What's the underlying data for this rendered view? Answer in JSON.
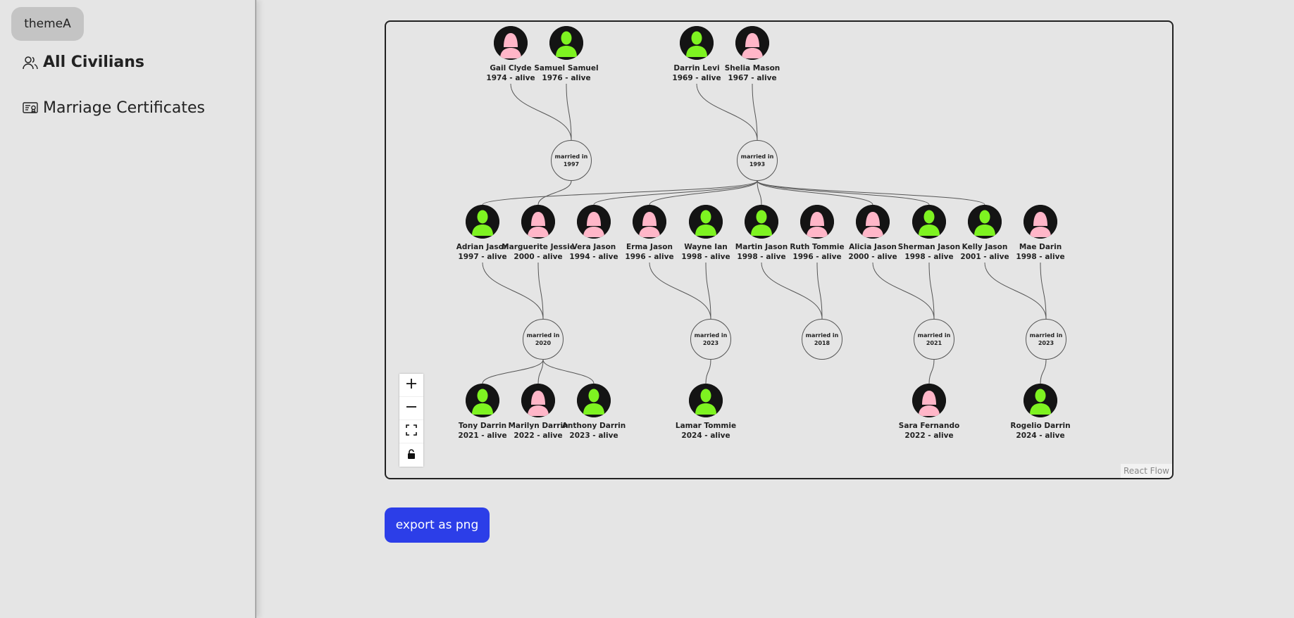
{
  "sidebar": {
    "theme_label": "themeA",
    "nav": {
      "all_civilians": "All Civilians",
      "marriage_certificates": "Marriage Certificates"
    }
  },
  "colors": {
    "male": "#7ef321",
    "female": "#ffb6c8",
    "accent": "#2c3ee8"
  },
  "people": [
    {
      "id": "gail",
      "name": "Gail Clyde",
      "years": "1974 - alive",
      "gender": "female"
    },
    {
      "id": "samuel",
      "name": "Samuel Samuel",
      "years": "1976 - alive",
      "gender": "male"
    },
    {
      "id": "darrin",
      "name": "Darrin Levi",
      "years": "1969 - alive",
      "gender": "male"
    },
    {
      "id": "shelia",
      "name": "Shelia Mason",
      "years": "1967 - alive",
      "gender": "female"
    },
    {
      "id": "adrian",
      "name": "Adrian Jason",
      "years": "1997 - alive",
      "gender": "male"
    },
    {
      "id": "marguerite",
      "name": "Marguerite Jessie",
      "years": "2000 - alive",
      "gender": "female"
    },
    {
      "id": "vera",
      "name": "Vera Jason",
      "years": "1994 - alive",
      "gender": "female"
    },
    {
      "id": "erma",
      "name": "Erma Jason",
      "years": "1996 - alive",
      "gender": "female"
    },
    {
      "id": "wayne",
      "name": "Wayne Ian",
      "years": "1998 - alive",
      "gender": "male"
    },
    {
      "id": "martin",
      "name": "Martin Jason",
      "years": "1998 - alive",
      "gender": "male"
    },
    {
      "id": "ruth",
      "name": "Ruth Tommie",
      "years": "1996 - alive",
      "gender": "female"
    },
    {
      "id": "alicia",
      "name": "Alicia Jason",
      "years": "2000 - alive",
      "gender": "female"
    },
    {
      "id": "sherman",
      "name": "Sherman Jason",
      "years": "1998 - alive",
      "gender": "male"
    },
    {
      "id": "kelly",
      "name": "Kelly Jason",
      "years": "2001 - alive",
      "gender": "male"
    },
    {
      "id": "mae",
      "name": "Mae Darin",
      "years": "1998 - alive",
      "gender": "female"
    },
    {
      "id": "tony",
      "name": "Tony Darrin",
      "years": "2021 - alive",
      "gender": "male"
    },
    {
      "id": "marilyn",
      "name": "Marilyn Darrin",
      "years": "2022 - alive",
      "gender": "female"
    },
    {
      "id": "anthony",
      "name": "Anthony Darrin",
      "years": "2023 - alive",
      "gender": "male"
    },
    {
      "id": "lamar",
      "name": "Lamar Tommie",
      "years": "2024 - alive",
      "gender": "male"
    },
    {
      "id": "sara",
      "name": "Sara Fernando",
      "years": "2022 - alive",
      "gender": "female"
    },
    {
      "id": "rogelio",
      "name": "Rogelio Darrin",
      "years": "2024 - alive",
      "gender": "male"
    }
  ],
  "marriages": [
    {
      "id": "m1",
      "label": "married in",
      "year": "1997",
      "partners": [
        "gail",
        "samuel"
      ],
      "children": [
        "marguerite"
      ]
    },
    {
      "id": "m2",
      "label": "married in",
      "year": "1993",
      "partners": [
        "darrin",
        "shelia"
      ],
      "children": [
        "adrian",
        "vera",
        "erma",
        "martin",
        "alicia",
        "sherman",
        "kelly"
      ]
    },
    {
      "id": "m3",
      "label": "married in",
      "year": "2020",
      "partners": [
        "adrian",
        "marguerite"
      ],
      "children": [
        "tony",
        "marilyn",
        "anthony"
      ]
    },
    {
      "id": "m4",
      "label": "married in",
      "year": "2023",
      "partners": [
        "erma",
        "wayne"
      ],
      "children": [
        "lamar"
      ]
    },
    {
      "id": "m5",
      "label": "married in",
      "year": "2018",
      "partners": [
        "martin",
        "ruth"
      ],
      "children": []
    },
    {
      "id": "m6",
      "label": "married in",
      "year": "2021",
      "partners": [
        "alicia",
        "sherman"
      ],
      "children": [
        "sara"
      ]
    },
    {
      "id": "m7",
      "label": "married in",
      "year": "2023",
      "partners": [
        "kelly",
        "mae"
      ],
      "children": [
        "rogelio"
      ]
    }
  ],
  "flow": {
    "attribution": "React Flow"
  },
  "controls": {
    "zoom_in": "plus-icon",
    "zoom_out": "minus-icon",
    "fit_view": "fit-view-icon",
    "lock": "lock-icon"
  },
  "export_label": "export as png"
}
